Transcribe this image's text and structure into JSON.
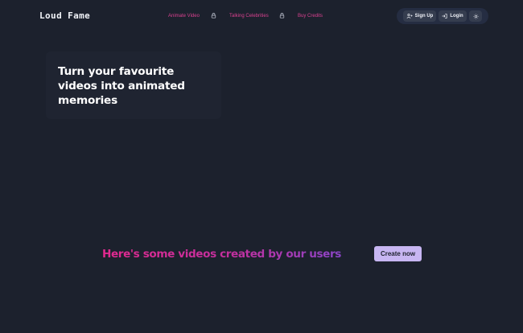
{
  "brand": {
    "name": "Loud Fame"
  },
  "nav": {
    "links": [
      {
        "label": "Animate Video",
        "icon": "lock-icon"
      },
      {
        "label": "Talking Celebrities",
        "icon": "lock-icon"
      },
      {
        "label": "Buy Credits"
      }
    ]
  },
  "auth": {
    "signup_label": "Sign Up",
    "login_label": "Login",
    "theme_icon": "sun-icon"
  },
  "hero": {
    "title": "Turn your favourite videos into animated memories"
  },
  "section": {
    "heading": "Here's some videos created by our users",
    "cta_label": "Create now"
  },
  "colors": {
    "background": "#1c212d",
    "nav_link": "#d9418f",
    "cta_background": "#c7b6f2",
    "heading_gradient_start": "#e2298f",
    "heading_gradient_end": "#8b45c8"
  }
}
